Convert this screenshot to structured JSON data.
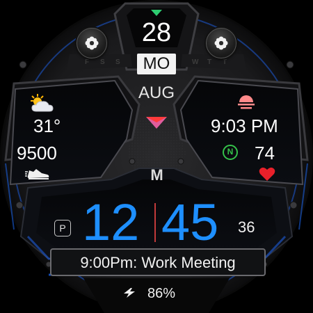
{
  "date": {
    "day_number": "28",
    "weekday": "MO",
    "month": "AUG",
    "weekday_strip_left": [
      "F",
      "S",
      "S"
    ],
    "weekday_strip_right": [
      "W",
      "T",
      "T"
    ]
  },
  "weather": {
    "icon": "partly-cloudy-icon",
    "temperature": "31°"
  },
  "steps": {
    "count": "9500",
    "icon": "sneaker-icon"
  },
  "sunset": {
    "icon": "sunset-icon",
    "time": "9:03 PM"
  },
  "heart": {
    "badge": "N",
    "bpm": "74",
    "icon": "heart-icon"
  },
  "time": {
    "hours": "12",
    "minutes": "45",
    "seconds": "36",
    "p_badge": "P"
  },
  "brand": {
    "logo_letter": "M"
  },
  "event": {
    "text": "9:00Pm: Work Meeting"
  },
  "battery": {
    "icon": "charging-bolt-icon",
    "percent": "86%",
    "level": 0.86
  },
  "colors": {
    "accent_blue": "#1e8fff",
    "heart_red": "#e8202a",
    "sunset_pink": "#ff8a8a",
    "badge_green": "#35c24a",
    "indicator_green": "#2ecc71",
    "marker_red": "#ff3b3b",
    "marker_pink": "#e05d9d"
  }
}
